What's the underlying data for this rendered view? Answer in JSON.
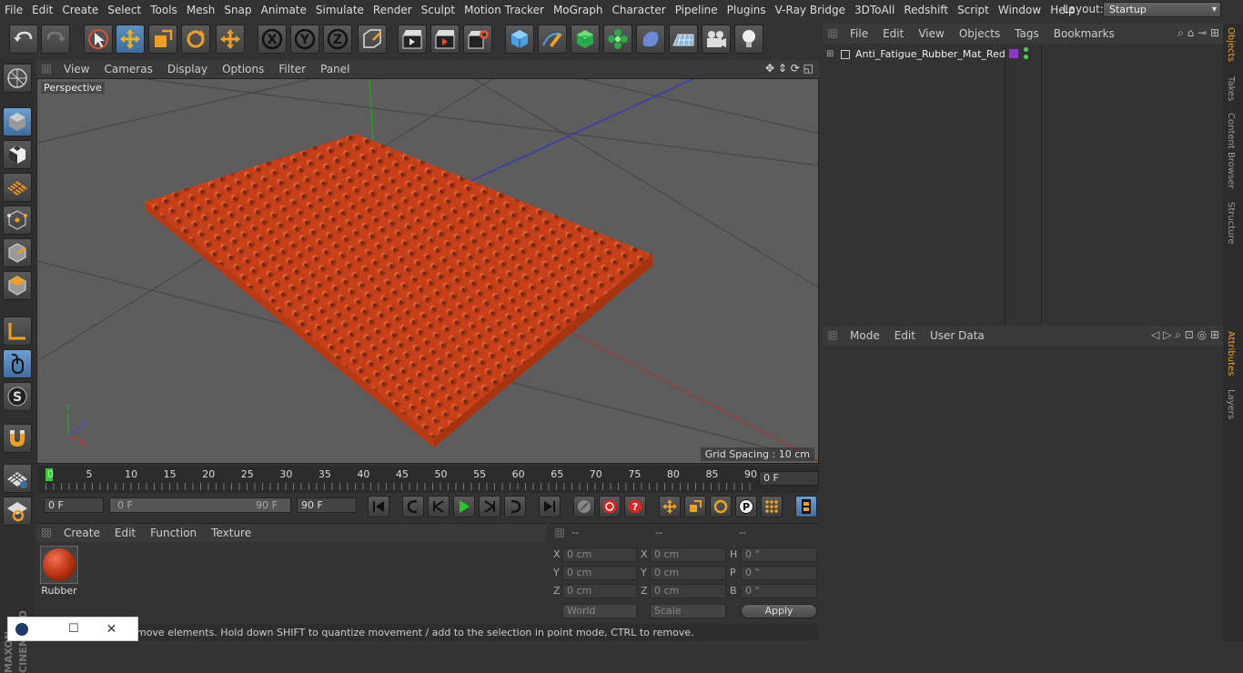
{
  "menubar": {
    "items": [
      "File",
      "Edit",
      "Create",
      "Select",
      "Tools",
      "Mesh",
      "Snap",
      "Animate",
      "Simulate",
      "Render",
      "Sculpt",
      "Motion Tracker",
      "MoGraph",
      "Character",
      "Pipeline",
      "Plugins",
      "V-Ray Bridge",
      "3DToAll",
      "Redshift",
      "Script",
      "Window",
      "Help"
    ],
    "layout_label": "Layout:",
    "layout_value": "Startup"
  },
  "viewport": {
    "menu": [
      "View",
      "Cameras",
      "Display",
      "Options",
      "Filter",
      "Panel"
    ],
    "label": "Perspective",
    "grid_spacing": "Grid Spacing : 10 cm",
    "mat_color": "#d4471c"
  },
  "timeline": {
    "ticks": [
      "0",
      "5",
      "10",
      "15",
      "20",
      "25",
      "30",
      "35",
      "40",
      "45",
      "50",
      "55",
      "60",
      "65",
      "70",
      "75",
      "80",
      "85",
      "90"
    ],
    "current_frame": "0 F"
  },
  "transport": {
    "start": "0 F",
    "range_start": "0 F",
    "range_end": "90 F",
    "end": "90 F"
  },
  "material": {
    "menu": [
      "Create",
      "Edit",
      "Function",
      "Texture"
    ],
    "name": "Rubber"
  },
  "coords": {
    "headers": [
      "--",
      "--",
      "--"
    ],
    "rows": [
      {
        "l1": "X",
        "v1": "0 cm",
        "l2": "X",
        "v2": "0 cm",
        "l3": "H",
        "v3": "0 °"
      },
      {
        "l1": "Y",
        "v1": "0 cm",
        "l2": "Y",
        "v2": "0 cm",
        "l3": "P",
        "v3": "0 °"
      },
      {
        "l1": "Z",
        "v1": "0 cm",
        "l2": "Z",
        "v2": "0 cm",
        "l3": "B",
        "v3": "0 °"
      }
    ],
    "mode1": "World",
    "mode2": "Scale",
    "apply": "Apply"
  },
  "status": "move elements. Hold down SHIFT to quantize movement / add to the selection in point mode, CTRL to remove.",
  "objects": {
    "menu": [
      "File",
      "Edit",
      "View",
      "Objects",
      "Tags",
      "Bookmarks"
    ],
    "object_name": "Anti_Fatigue_Rubber_Mat_Red"
  },
  "attributes": {
    "menu": [
      "Mode",
      "Edit",
      "User Data"
    ]
  },
  "right_tabs": [
    "Objects",
    "Takes",
    "Content Browser",
    "Structure",
    "Attributes",
    "Layers"
  ],
  "logo": "MAXON CINEMA 4D"
}
